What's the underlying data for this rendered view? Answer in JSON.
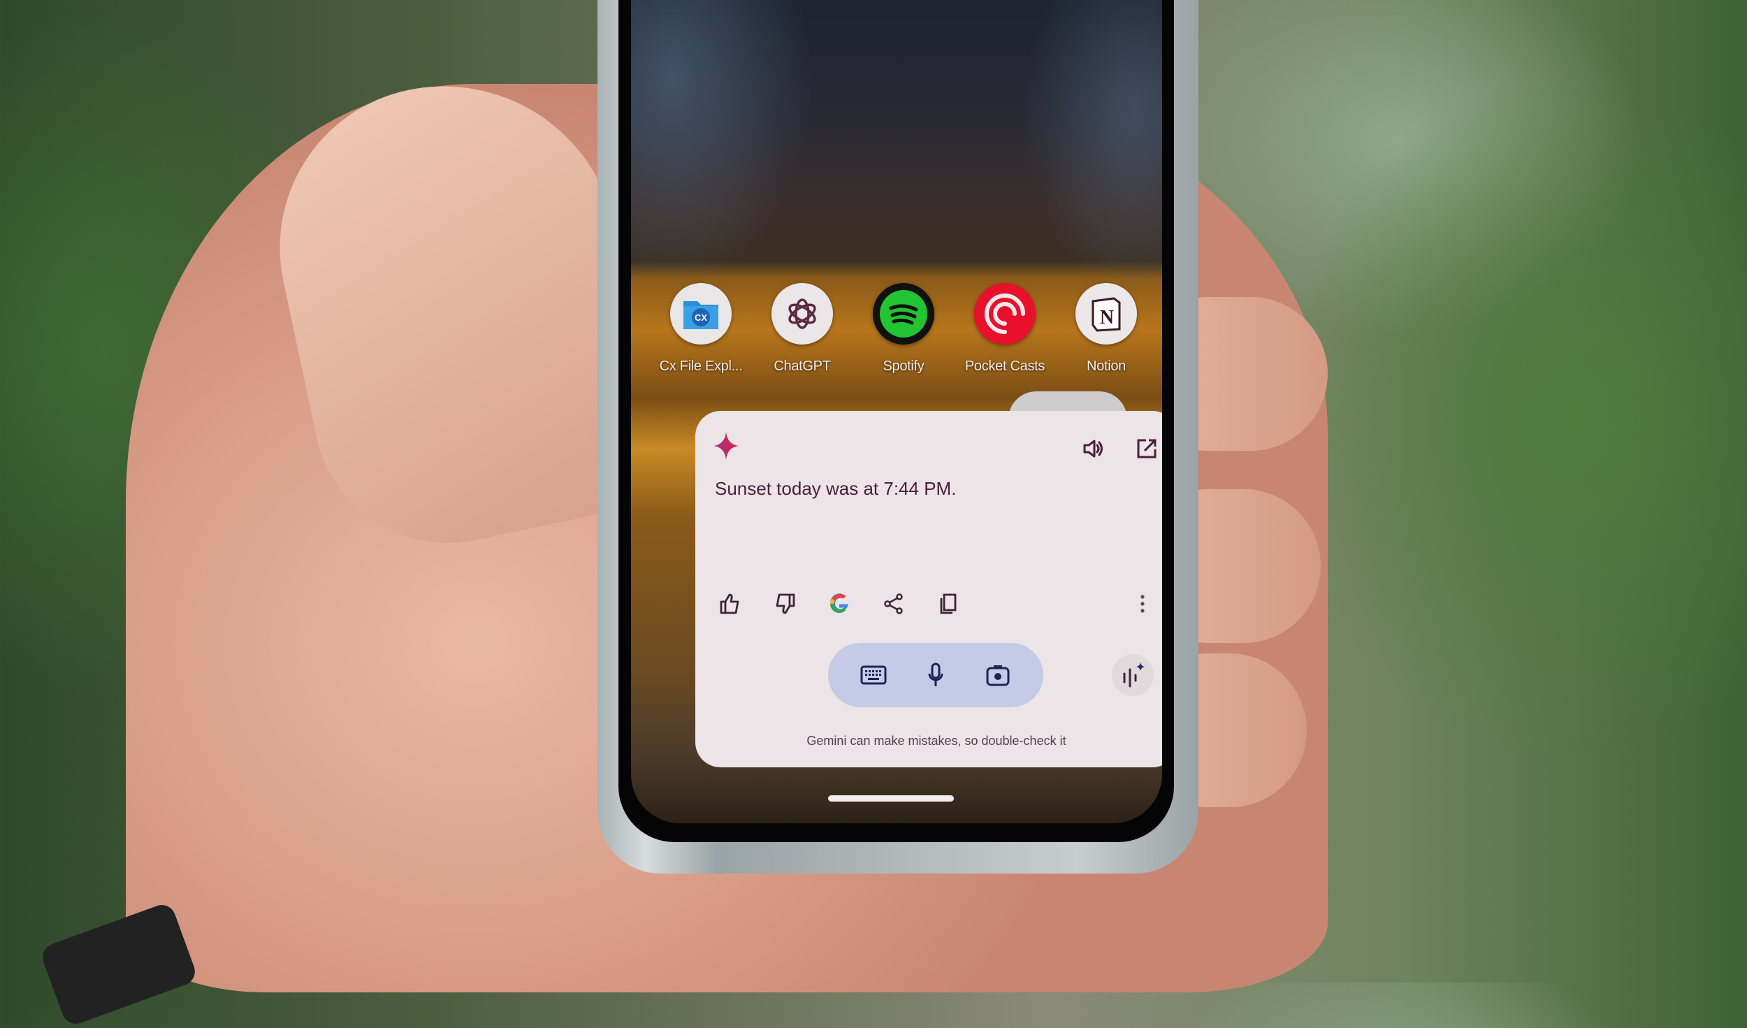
{
  "scene": {
    "description": "Hand holding a phone showing the Gemini overlay on an Android home screen"
  },
  "home_screen": {
    "apps": [
      {
        "label": "Cx File Expl...",
        "icon": "cx-file-explorer-icon",
        "bg": "#e9e6e8"
      },
      {
        "label": "ChatGPT",
        "icon": "chatgpt-icon",
        "bg": "#ebe6e8"
      },
      {
        "label": "Spotify",
        "icon": "spotify-icon",
        "bg": "#111111"
      },
      {
        "label": "Pocket Casts",
        "icon": "pocket-casts-icon",
        "bg": "#e8102a"
      },
      {
        "label": "Notion",
        "icon": "notion-icon",
        "bg": "#ece8ea"
      }
    ]
  },
  "gemini": {
    "logo_icon": "gemini-sparkle-icon",
    "accent_color": "#d6214f",
    "header_actions": [
      {
        "name": "read-aloud",
        "icon": "speaker-icon"
      },
      {
        "name": "open-in-app",
        "icon": "open-external-icon"
      }
    ],
    "response_text": "Sunset today was at 7:44 PM.",
    "response_actions": [
      {
        "name": "thumbs-up",
        "icon": "thumbs-up-icon"
      },
      {
        "name": "thumbs-down",
        "icon": "thumbs-down-icon"
      },
      {
        "name": "google-search",
        "icon": "google-g-icon"
      },
      {
        "name": "share",
        "icon": "share-icon"
      },
      {
        "name": "copy",
        "icon": "copy-icon"
      },
      {
        "name": "more",
        "icon": "more-vertical-icon"
      }
    ],
    "input_modes": [
      {
        "name": "keyboard",
        "icon": "keyboard-icon"
      },
      {
        "name": "voice",
        "icon": "microphone-icon"
      },
      {
        "name": "camera",
        "icon": "camera-icon"
      }
    ],
    "live_icon": "gemini-live-icon",
    "disclaimer": "Gemini can make mistakes, so double-check it"
  }
}
